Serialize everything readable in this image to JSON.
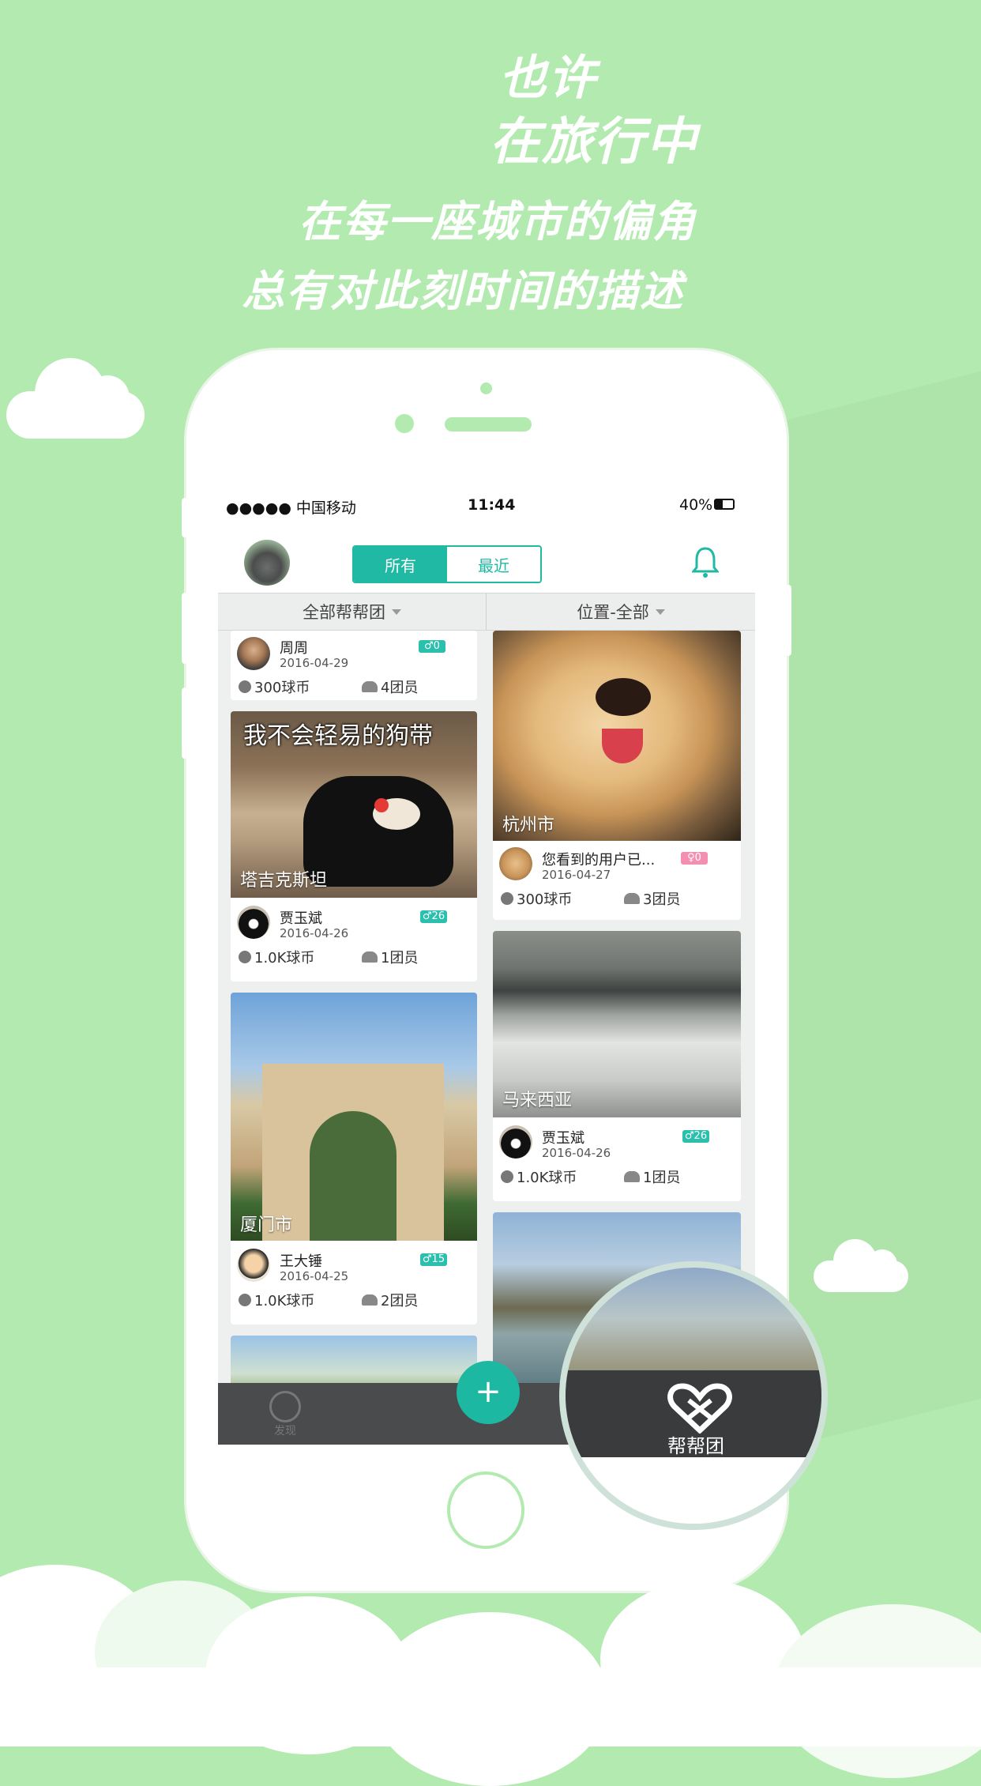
{
  "headlines": [
    "也许",
    "在旅行中",
    "在每一座城市的偏角",
    "总有对此刻时间的描述"
  ],
  "status_bar": {
    "carrier": "●●●●● 中国移动",
    "time": "11:44",
    "battery": "40%"
  },
  "nav": {
    "tabs": [
      {
        "label": "所有",
        "active": true
      },
      {
        "label": "最近",
        "active": false
      }
    ],
    "bell_icon": "bell-icon",
    "avatar_icon": "totoro-avatar"
  },
  "filters": {
    "group": "全部帮帮团",
    "location": "位置-全部"
  },
  "cards_left": [
    {
      "place": "",
      "user": "周周",
      "date": "2016-04-29",
      "badge": "♂0",
      "badge_color": "#2bbfae",
      "coins": "300球币",
      "members": "4团员"
    },
    {
      "caption": "我不会轻易的狗带",
      "place": "塔吉克斯坦",
      "user": "贾玉斌",
      "date": "2016-04-26",
      "badge": "♂26",
      "badge_color": "#2bbfae",
      "coins": "1.0K球币",
      "members": "1团员"
    },
    {
      "place": "厦门市",
      "user": "王大锤",
      "date": "2016-04-25",
      "badge": "♂15",
      "badge_color": "#2bbfae",
      "coins": "1.0K球币",
      "members": "2团员"
    }
  ],
  "cards_right": [
    {
      "place": "杭州市",
      "user": "您看到的用户已...",
      "date": "2016-04-27",
      "badge": "♀0",
      "badge_color": "#f48fb1",
      "coins": "300球币",
      "members": "3团员"
    },
    {
      "place": "马来西亚",
      "user": "贾玉斌",
      "date": "2016-04-26",
      "badge": "♂26",
      "badge_color": "#2bbfae",
      "coins": "1.0K球币",
      "members": "1团员"
    }
  ],
  "tabbar": {
    "discover": "发现",
    "add": "+",
    "group": "帮帮团"
  },
  "colors": {
    "background": "#b3eab0",
    "accent": "#1fb9a4",
    "tabbar": "#4a4b4d"
  }
}
